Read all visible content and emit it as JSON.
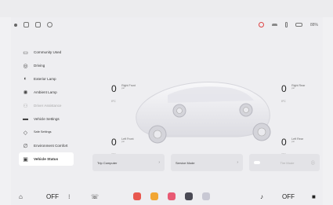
{
  "status_bar": {
    "left_icons": [
      "wifi-dot-icon",
      "bluetooth-icon",
      "camera-icon",
      "settings-icon"
    ],
    "right_icons": [
      "record-icon",
      "signal-icon",
      "lock-icon",
      "battery-icon"
    ],
    "right_text": "88%"
  },
  "sidebar": {
    "items": [
      {
        "icon": "community-icon",
        "glyph": "▭",
        "label": "Community Used",
        "state": "normal"
      },
      {
        "icon": "driving-icon",
        "glyph": "◎",
        "label": "Driving",
        "state": "normal"
      },
      {
        "icon": "exterior-lamp-icon",
        "glyph": "◐",
        "label": "Exterior Lamp",
        "state": "normal"
      },
      {
        "icon": "ambient-lamp-icon",
        "glyph": "✺",
        "label": "Ambient Lamp",
        "state": "normal"
      },
      {
        "icon": "driver-assistance-icon",
        "glyph": "⚇",
        "label": "Driver Assistance",
        "state": "disabled"
      },
      {
        "icon": "vehicle-settings-icon",
        "glyph": "▬",
        "label": "Vehicle Settings",
        "state": "normal"
      },
      {
        "icon": "safe-settings-icon",
        "glyph": "◇",
        "label": "Safe Settings",
        "state": "small"
      },
      {
        "icon": "environment-comfort-icon",
        "glyph": "∅",
        "label": "Environment Comfort",
        "state": "normal"
      },
      {
        "icon": "vehicle-status-icon",
        "glyph": "▣",
        "label": "Vehicle Status",
        "state": "active"
      }
    ]
  },
  "tires": {
    "front_right": {
      "value": "0",
      "name": "Right Front",
      "unit": "psi",
      "temp": "0°C"
    },
    "rear_right": {
      "value": "0",
      "name": "Right Rear",
      "unit": "psi",
      "temp": "0°C"
    },
    "front_left": {
      "value": "0",
      "name": "Left Front",
      "unit": "psi",
      "temp": "0°C"
    },
    "rear_left": {
      "value": "0",
      "name": "Left Rear",
      "unit": "psi",
      "temp": "0°C"
    }
  },
  "cards": {
    "trip_computer": "Trip Computer",
    "service_mode": "Service Mode",
    "tire_mode": "Tire Mode"
  },
  "bottom_bar": {
    "left_temp": "OFF",
    "right_temp": "OFF"
  },
  "colors": {
    "app1": "#e8584f",
    "app2": "#f2a634",
    "app3": "#e85a74",
    "app4": "#4a4a55",
    "app5": "#c8c8d4"
  }
}
